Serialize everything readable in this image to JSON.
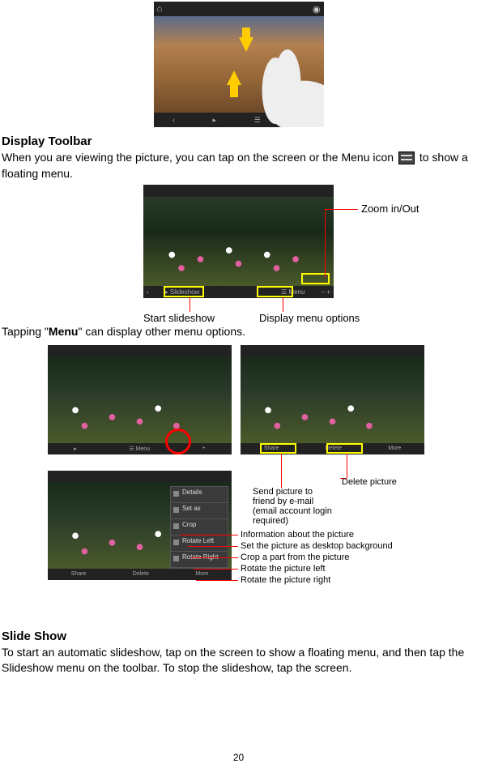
{
  "section1_title": "Display Toolbar",
  "section1_p_a": "When you are viewing the picture, you can tap on the screen or the Menu icon ",
  "section1_p_b": " to show a floating menu.",
  "toolbar": {
    "zoom": "Zoom in/Out",
    "slideshow": "Start slideshow",
    "menu": "Display menu options"
  },
  "tapping_p": {
    "a": "Tapping \"",
    "b": "Menu",
    "c": "\" can display other menu options."
  },
  "share_callout": "Send picture to friend by e-mail (email account login required)",
  "delete_callout": "Delete picture",
  "menu_items": {
    "info": "Information about the picture",
    "wallpaper": "Set the picture as desktop background",
    "crop": "Crop a part from the picture",
    "rotate_left": "Rotate the picture left",
    "rotate_right": "Rotate the picture right"
  },
  "popup_labels": {
    "details": "Details",
    "setas": "Set as",
    "crop": "Crop",
    "rotL": "Rotate Left",
    "rotR": "Rotate Right"
  },
  "section2_title": "Slide Show",
  "section2_p": "To start an automatic slideshow, tap on the screen to show a floating menu, and then tap the Slideshow menu on the toolbar. To stop the slideshow, tap the screen.",
  "page_number": "20"
}
